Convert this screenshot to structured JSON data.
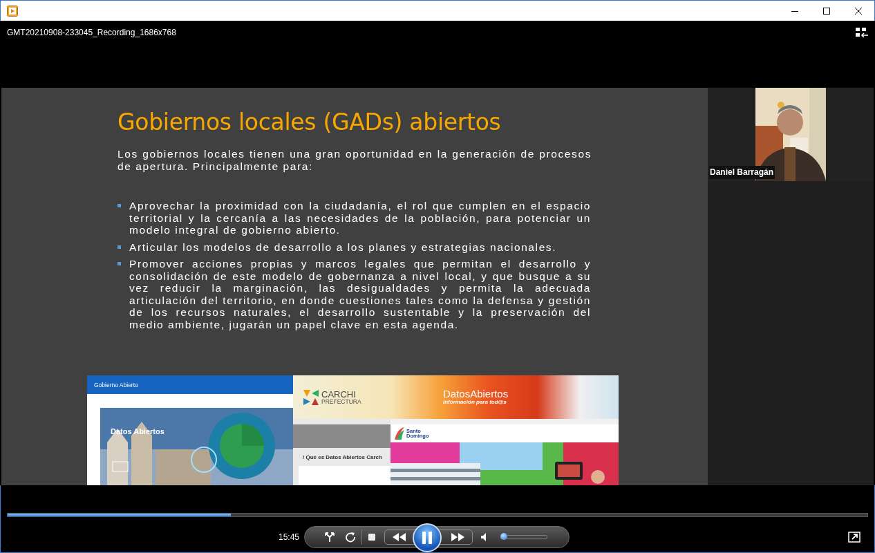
{
  "window": {
    "title": "GMT20210908-233045_Recording_1686x768"
  },
  "slide": {
    "title": "Gobiernos locales (GADs) abiertos",
    "intro": "Los gobiernos locales tienen una gran oportunidad en la generación de procesos de apertura. Principalmente para:",
    "bullets": [
      "Aprovechar la proximidad con la ciudadanía, el rol que cumplen en el espacio territorial y la cercanía a las necesidades de la población, para potenciar un modelo integral de gobierno abierto.",
      "Articular los modelos de desarrollo a los planes y estrategias nacionales.",
      "Promover acciones propias y marcos legales que permitan el desarrollo y consolidación de este modelo de gobernanza a nivel local, y que busque a su vez reducir la marginación, las desigualdades y permita la adecuada articulación del territorio, en donde cuestiones tales como la defensa y gestión de los recursos naturales, el desarrollo sustentable y la preservación del medio ambiente, jugarán un papel clave en esta agenda."
    ],
    "screenshots": [
      {
        "kind": "portal",
        "site_title": "Gobierno Abierto",
        "heading": "Datos Abiertos"
      },
      {
        "kind": "banner",
        "brand": "CARCHI",
        "brand_sub": "PREFECTURA",
        "banner_title": "DatosAbiertos",
        "banner_sub": "información para tod@s",
        "breadcrumb": "/ Qué es Datos Abiertos Carch"
      },
      {
        "kind": "municipal",
        "brand_lines": [
          "Santo",
          "Domingo"
        ]
      }
    ]
  },
  "webcam": {
    "name": "Daniel Barragán"
  },
  "player": {
    "elapsed": "15:45",
    "playing": true,
    "progress": {
      "level": 0.26
    },
    "volume": {
      "level": 0.06
    }
  }
}
